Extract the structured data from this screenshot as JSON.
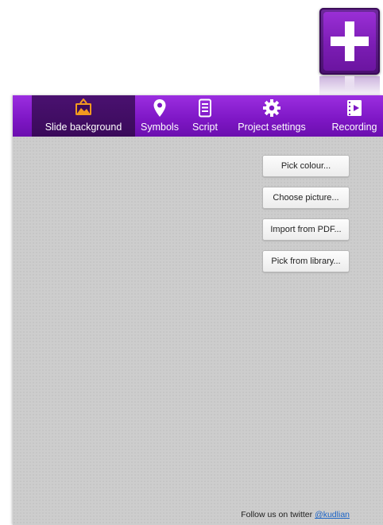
{
  "logo": {
    "icon": "plus-icon",
    "accent": "#7c1db5"
  },
  "toolbar": {
    "color": "#8a1fd0",
    "items": [
      {
        "label": "Slide background",
        "icon": "picture-frame-icon",
        "active": true
      },
      {
        "label": "Symbols",
        "icon": "map-pin-icon",
        "active": false
      },
      {
        "label": "Script",
        "icon": "document-icon",
        "active": false
      },
      {
        "label": "Project settings",
        "icon": "gear-icon",
        "active": false
      },
      {
        "label": "Recording",
        "icon": "film-icon",
        "active": false
      }
    ]
  },
  "actions": {
    "pick_colour": "Pick colour...",
    "choose_picture": "Choose picture...",
    "import_pdf": "Import from PDF...",
    "pick_library": "Pick from library..."
  },
  "footer": {
    "text": "Follow us on twitter ",
    "link": "@kudlian",
    "link_color": "#1a63c7"
  }
}
